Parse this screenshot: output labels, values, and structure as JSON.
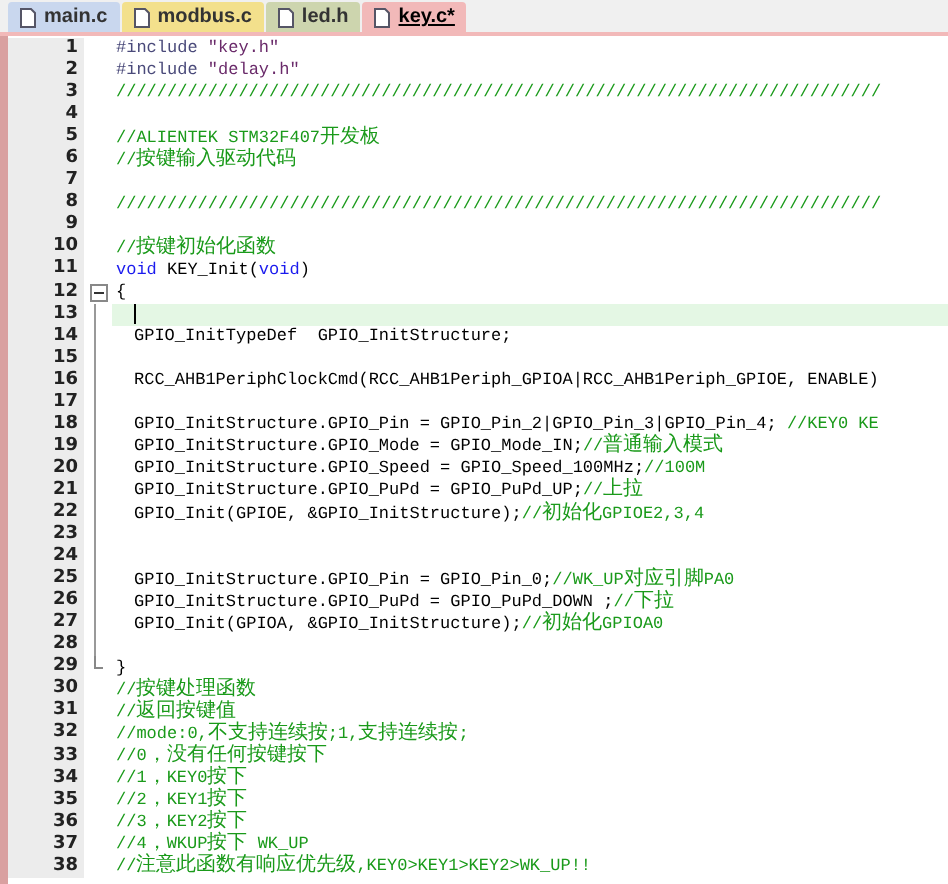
{
  "tabs": [
    {
      "label": "main.c",
      "selected": false,
      "color": "#c9d7ee"
    },
    {
      "label": "modbus.c",
      "selected": false,
      "color": "#f3e08c"
    },
    {
      "label": "led.h",
      "selected": false,
      "color": "#cdd5ae"
    },
    {
      "label": "key.c*",
      "selected": true,
      "color": "#f2b9b9"
    }
  ],
  "editor": {
    "lines": [
      {
        "number": "1",
        "current": false,
        "indented": false,
        "fold_start": false,
        "fold_end": false,
        "segments": [
          {
            "kind": "preprocessor",
            "text": "#include "
          },
          {
            "kind": "string",
            "text": "\"key.h\""
          }
        ]
      },
      {
        "number": "2",
        "current": false,
        "indented": false,
        "fold_start": false,
        "fold_end": false,
        "segments": [
          {
            "kind": "preprocessor",
            "text": "#include "
          },
          {
            "kind": "string",
            "text": "\"delay.h\""
          }
        ]
      },
      {
        "number": "3",
        "current": false,
        "indented": false,
        "fold_start": false,
        "fold_end": false,
        "segments": [
          {
            "kind": "comment",
            "text": "///////////////////////////////////////////////////////////////////////////"
          }
        ]
      },
      {
        "number": "4",
        "current": false,
        "fold_start": false,
        "fold_end": false
      },
      {
        "number": "5",
        "current": false,
        "indented": false,
        "fold_start": false,
        "fold_end": false,
        "segments": [
          {
            "kind": "comment",
            "text": "//ALIENTEK STM32F407开发板"
          }
        ]
      },
      {
        "number": "6",
        "current": false,
        "indented": false,
        "fold_start": false,
        "fold_end": false,
        "segments": [
          {
            "kind": "comment",
            "text": "//按键输入驱动代码"
          }
        ]
      },
      {
        "number": "7",
        "current": false,
        "fold_start": false,
        "fold_end": false
      },
      {
        "number": "8",
        "current": false,
        "indented": false,
        "fold_start": false,
        "fold_end": false,
        "segments": [
          {
            "kind": "comment",
            "text": "///////////////////////////////////////////////////////////////////////////"
          }
        ]
      },
      {
        "number": "9",
        "current": false,
        "fold_start": false,
        "fold_end": false
      },
      {
        "number": "10",
        "current": false,
        "indented": false,
        "fold_start": false,
        "fold_end": false,
        "segments": [
          {
            "kind": "comment",
            "text": "//按键初始化函数"
          }
        ]
      },
      {
        "number": "11",
        "current": false,
        "indented": false,
        "fold_start": false,
        "fold_end": false,
        "segments": [
          {
            "kind": "keyword",
            "text": "void"
          },
          {
            "kind": "code",
            "text": " KEY_Init("
          },
          {
            "kind": "keyword",
            "text": "void"
          },
          {
            "kind": "code",
            "text": ")"
          }
        ]
      },
      {
        "number": "12",
        "current": false,
        "indented": false,
        "fold_start": true,
        "fold_end": false,
        "segments": [
          {
            "kind": "code",
            "text": "{"
          }
        ]
      },
      {
        "number": "13",
        "current": true,
        "indented": true,
        "fold_start": false,
        "fold_end": false
      },
      {
        "number": "14",
        "current": false,
        "indented": true,
        "fold_start": false,
        "fold_end": false,
        "segments": [
          {
            "kind": "code",
            "text": "GPIO_InitTypeDef  GPIO_InitStructure;"
          }
        ]
      },
      {
        "number": "15",
        "current": false,
        "fold_start": false,
        "fold_end": false
      },
      {
        "number": "16",
        "current": false,
        "indented": true,
        "fold_start": false,
        "fold_end": false,
        "segments": [
          {
            "kind": "code",
            "text": "RCC_AHB1PeriphClockCmd(RCC_AHB1Periph_GPIOA|RCC_AHB1Periph_GPIOE, ENABLE)"
          }
        ]
      },
      {
        "number": "17",
        "current": false,
        "fold_start": false,
        "fold_end": false
      },
      {
        "number": "18",
        "current": false,
        "indented": true,
        "fold_start": false,
        "fold_end": false,
        "segments": [
          {
            "kind": "code",
            "text": "GPIO_InitStructure.GPIO_Pin = GPIO_Pin_2|GPIO_Pin_3|GPIO_Pin_4; "
          },
          {
            "kind": "comment",
            "text": "//KEY0 KE"
          }
        ]
      },
      {
        "number": "19",
        "current": false,
        "indented": true,
        "fold_start": false,
        "fold_end": false,
        "segments": [
          {
            "kind": "code",
            "text": "GPIO_InitStructure.GPIO_Mode = GPIO_Mode_IN;"
          },
          {
            "kind": "comment",
            "text": "//普通输入模式"
          }
        ]
      },
      {
        "number": "20",
        "current": false,
        "indented": true,
        "fold_start": false,
        "fold_end": false,
        "segments": [
          {
            "kind": "code",
            "text": "GPIO_InitStructure.GPIO_Speed = GPIO_Speed_100MHz;"
          },
          {
            "kind": "comment",
            "text": "//100M"
          }
        ]
      },
      {
        "number": "21",
        "current": false,
        "indented": true,
        "fold_start": false,
        "fold_end": false,
        "segments": [
          {
            "kind": "code",
            "text": "GPIO_InitStructure.GPIO_PuPd = GPIO_PuPd_UP;"
          },
          {
            "kind": "comment",
            "text": "//上拉"
          }
        ]
      },
      {
        "number": "22",
        "current": false,
        "indented": true,
        "fold_start": false,
        "fold_end": false,
        "segments": [
          {
            "kind": "code",
            "text": "GPIO_Init(GPIOE, &GPIO_InitStructure);"
          },
          {
            "kind": "comment",
            "text": "//初始化GPIOE2,3,4"
          }
        ]
      },
      {
        "number": "23",
        "current": false,
        "fold_start": false,
        "fold_end": false
      },
      {
        "number": "24",
        "current": false,
        "fold_start": false,
        "fold_end": false
      },
      {
        "number": "25",
        "current": false,
        "indented": true,
        "fold_start": false,
        "fold_end": false,
        "segments": [
          {
            "kind": "code",
            "text": "GPIO_InitStructure.GPIO_Pin = GPIO_Pin_0;"
          },
          {
            "kind": "comment",
            "text": "//WK_UP对应引脚PA0"
          }
        ]
      },
      {
        "number": "26",
        "current": false,
        "indented": true,
        "fold_start": false,
        "fold_end": false,
        "segments": [
          {
            "kind": "code",
            "text": "GPIO_InitStructure.GPIO_PuPd = GPIO_PuPd_DOWN ;"
          },
          {
            "kind": "comment",
            "text": "//下拉"
          }
        ]
      },
      {
        "number": "27",
        "current": false,
        "indented": true,
        "fold_start": false,
        "fold_end": false,
        "segments": [
          {
            "kind": "code",
            "text": "GPIO_Init(GPIOA, &GPIO_InitStructure);"
          },
          {
            "kind": "comment",
            "text": "//初始化GPIOA0"
          }
        ]
      },
      {
        "number": "28",
        "current": false,
        "fold_start": false,
        "fold_end": false
      },
      {
        "number": "29",
        "current": false,
        "indented": false,
        "fold_start": false,
        "fold_end": true,
        "segments": [
          {
            "kind": "code",
            "text": "}"
          }
        ]
      },
      {
        "number": "30",
        "current": false,
        "indented": false,
        "fold_start": false,
        "fold_end": false,
        "segments": [
          {
            "kind": "comment",
            "text": "//按键处理函数"
          }
        ]
      },
      {
        "number": "31",
        "current": false,
        "indented": false,
        "fold_start": false,
        "fold_end": false,
        "segments": [
          {
            "kind": "comment",
            "text": "//返回按键值"
          }
        ]
      },
      {
        "number": "32",
        "current": false,
        "indented": false,
        "fold_start": false,
        "fold_end": false,
        "segments": [
          {
            "kind": "comment",
            "text": "//mode:0,不支持连续按;1,支持连续按;"
          }
        ]
      },
      {
        "number": "33",
        "current": false,
        "indented": false,
        "fold_start": false,
        "fold_end": false,
        "segments": [
          {
            "kind": "comment",
            "text": "//0，没有任何按键按下"
          }
        ]
      },
      {
        "number": "34",
        "current": false,
        "indented": false,
        "fold_start": false,
        "fold_end": false,
        "segments": [
          {
            "kind": "comment",
            "text": "//1，KEY0按下"
          }
        ]
      },
      {
        "number": "35",
        "current": false,
        "indented": false,
        "fold_start": false,
        "fold_end": false,
        "segments": [
          {
            "kind": "comment",
            "text": "//2，KEY1按下"
          }
        ]
      },
      {
        "number": "36",
        "current": false,
        "indented": false,
        "fold_start": false,
        "fold_end": false,
        "segments": [
          {
            "kind": "comment",
            "text": "//3，KEY2按下"
          }
        ]
      },
      {
        "number": "37",
        "current": false,
        "indented": false,
        "fold_start": false,
        "fold_end": false,
        "segments": [
          {
            "kind": "comment",
            "text": "//4，WKUP按下 WK_UP"
          }
        ]
      },
      {
        "number": "38",
        "current": false,
        "indented": false,
        "fold_start": false,
        "fold_end": false,
        "segments": [
          {
            "kind": "comment",
            "text": "//注意此函数有响应优先级,KEY0>KEY1>KEY2>WK_UP!!"
          }
        ]
      }
    ]
  }
}
